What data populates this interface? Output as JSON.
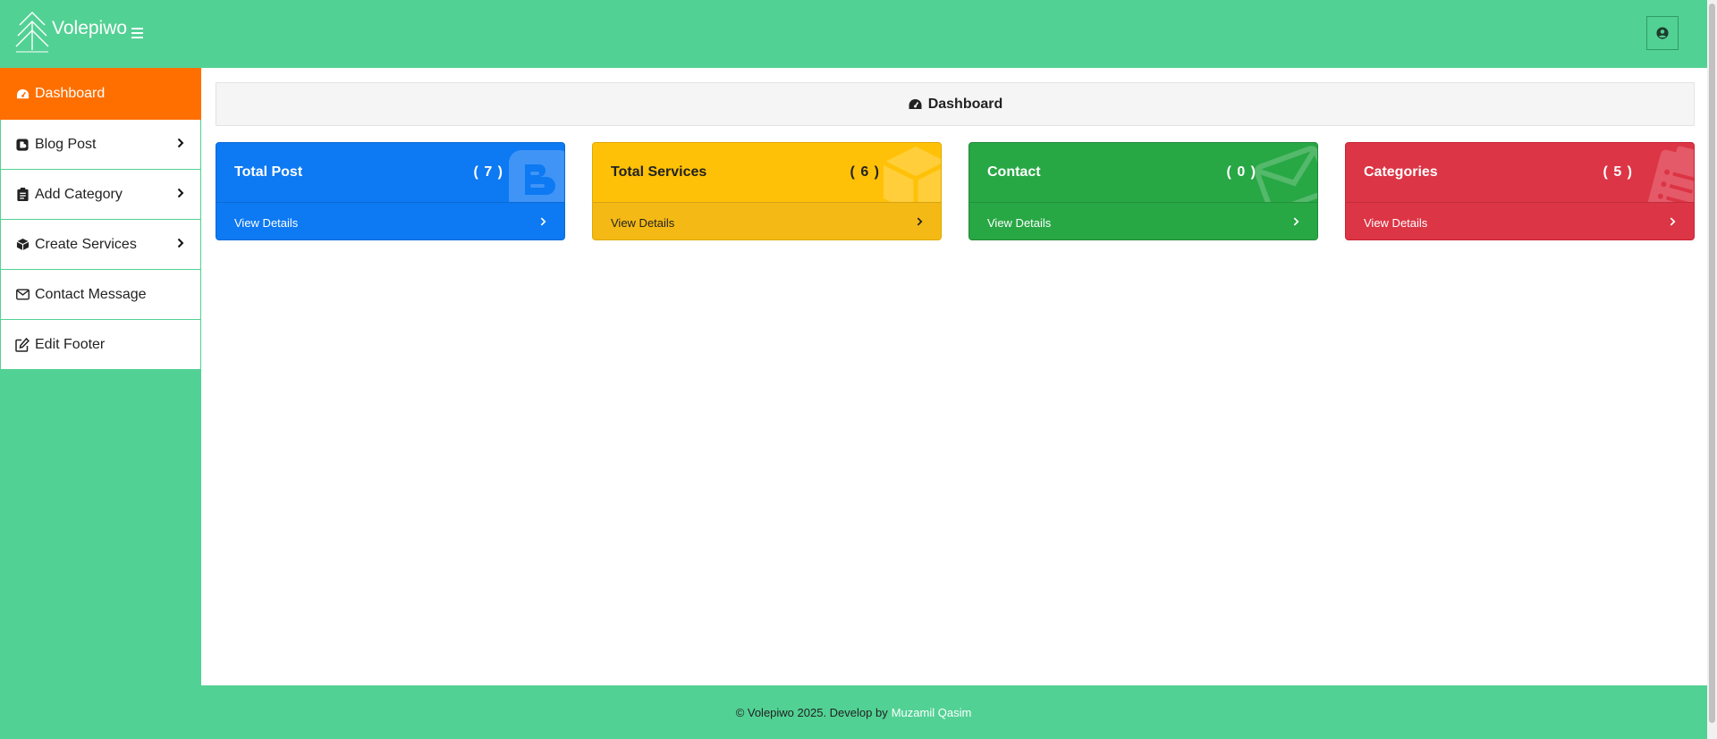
{
  "header": {
    "brand_name": "Volepiwo",
    "brand_logo": "pine-tree-logo",
    "menu_icon": "hamburger-icon",
    "user_icon": "user-circle-icon"
  },
  "sidebar": {
    "items": [
      {
        "label": "Dashboard",
        "icon": "gauge-icon",
        "active": true,
        "has_submenu": false
      },
      {
        "label": "Blog Post",
        "icon": "blogger-icon",
        "active": false,
        "has_submenu": true
      },
      {
        "label": "Add Category",
        "icon": "clipboard-list-icon",
        "active": false,
        "has_submenu": true
      },
      {
        "label": "Create Services",
        "icon": "cube-icon",
        "active": false,
        "has_submenu": true
      },
      {
        "label": "Contact Message",
        "icon": "envelope-icon",
        "active": false,
        "has_submenu": false
      },
      {
        "label": "Edit Footer",
        "icon": "edit-icon",
        "active": false,
        "has_submenu": false
      }
    ]
  },
  "main": {
    "page_title": "Dashboard",
    "cards": [
      {
        "title": "Total Post",
        "count": "( 7 )",
        "link": "View Details",
        "icon": "blogger-icon",
        "color": "#0d79f2"
      },
      {
        "title": "Total Services",
        "count": "( 6 )",
        "link": "View Details",
        "icon": "cube-icon",
        "color": "#ffc107"
      },
      {
        "title": "Contact",
        "count": "( 0 )",
        "link": "View Details",
        "icon": "envelope-icon",
        "color": "#28a745"
      },
      {
        "title": "Categories",
        "count": "( 5 )",
        "link": "View Details",
        "icon": "clipboard-list-icon",
        "color": "#dc3545"
      }
    ]
  },
  "footer": {
    "text": "© Volepiwo 2025. Develop by",
    "author": "Muzamil Qasim"
  },
  "colors": {
    "brand_green": "#52d194",
    "active_orange": "#ff6f00"
  }
}
